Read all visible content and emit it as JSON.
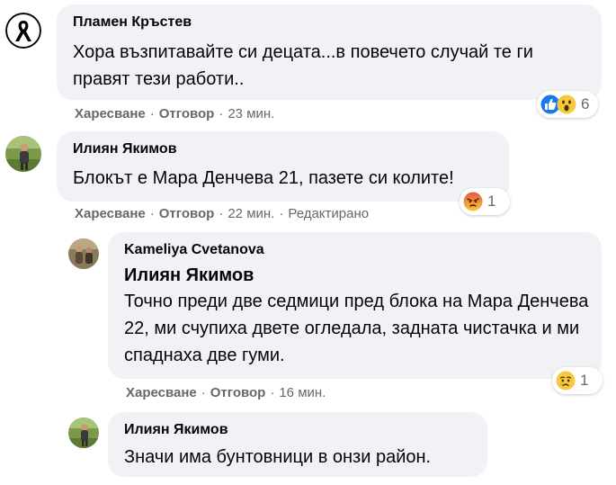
{
  "comments": [
    {
      "author": "Пламен Кръстев",
      "text": "Хора възпитавайте си децата...в повечето случай те ги правят тези работи..",
      "reactions": {
        "icons": [
          "like-icon",
          "wow-icon"
        ],
        "count": "6"
      },
      "actions": {
        "like": "Харесване",
        "reply": "Отговор",
        "time": "23 мин.",
        "edited": ""
      }
    },
    {
      "author": "Илиян Якимов",
      "text": "Блокът е Мара Денчева 21, пазете си колите!",
      "reactions": {
        "icons": [
          "angry-icon"
        ],
        "count": "1"
      },
      "actions": {
        "like": "Харесване",
        "reply": "Отговор",
        "time": "22 мин.",
        "edited": "Редактирано"
      }
    }
  ],
  "replies": [
    {
      "author": "Kameliya Cvetanova",
      "mention": "Илиян Якимов",
      "text": "Точно преди две седмици пред блока на Мара Денчева 22, ми счупиха двете огледала, задната чистачка и ми спаднаха две гуми.",
      "reactions": {
        "icons": [
          "sad-icon"
        ],
        "count": "1"
      },
      "actions": {
        "like": "Харесване",
        "reply": "Отговор",
        "time": "16 мин."
      }
    },
    {
      "author": "Илиян Якимов",
      "text": "Значи има бунтовници в онзи район."
    }
  ],
  "separator": "·",
  "colors": {
    "bubble": "#f0f2f5",
    "meta": "#65676b",
    "like_blue": "#1877f2",
    "emoji_yellow": "#f7c940",
    "angry_red": "#e9573f"
  }
}
